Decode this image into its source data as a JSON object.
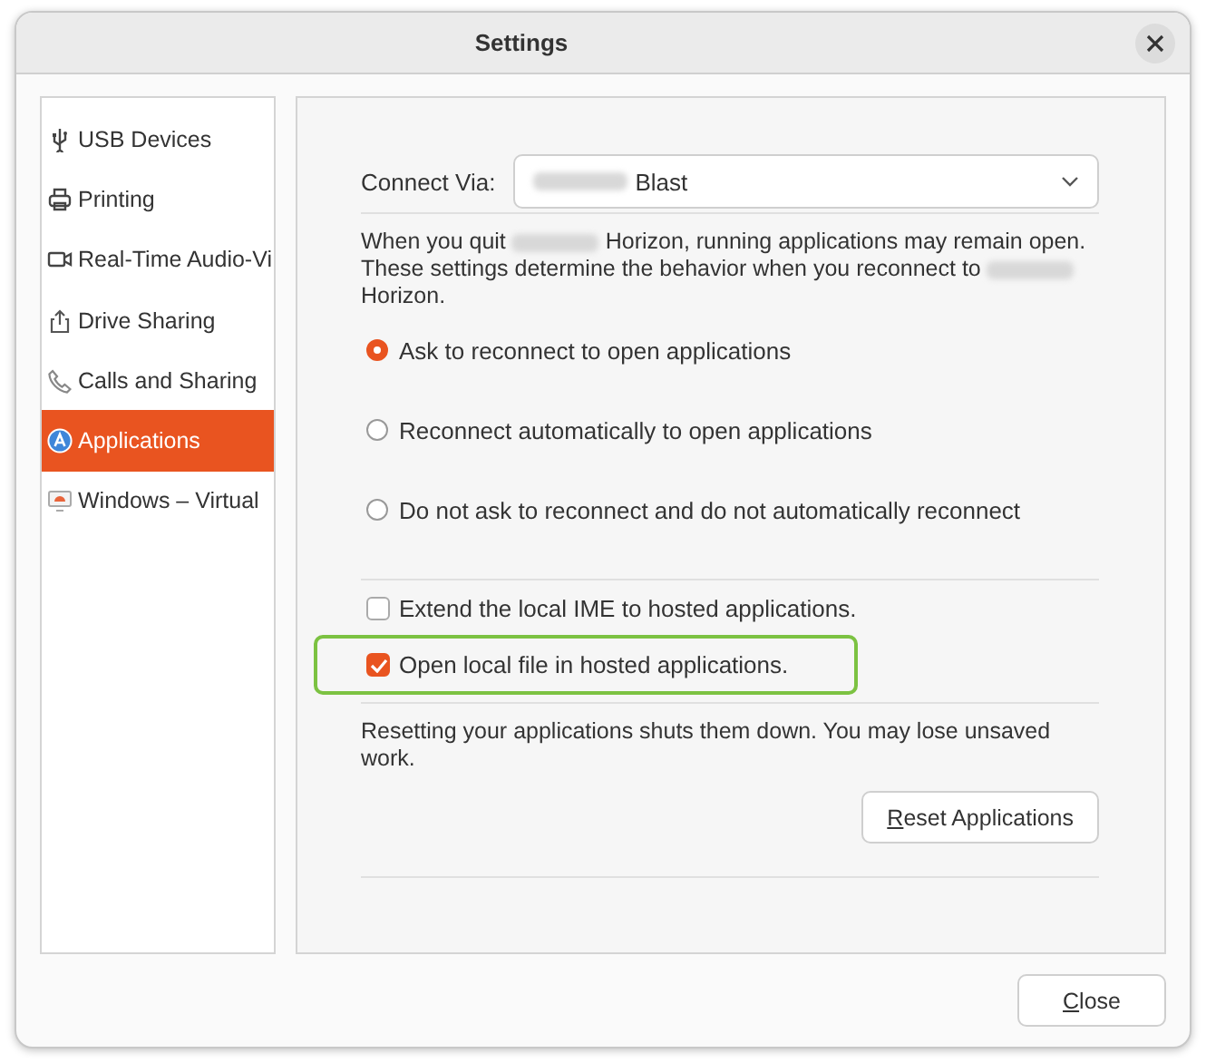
{
  "window": {
    "title": "Settings"
  },
  "sidebar": {
    "items": [
      {
        "label": "USB Devices",
        "selected": false
      },
      {
        "label": "Printing",
        "selected": false
      },
      {
        "label": "Real-Time Audio-Vi",
        "selected": false
      },
      {
        "label": "Drive Sharing",
        "selected": false
      },
      {
        "label": "Calls and Sharing",
        "selected": false
      },
      {
        "label": "Applications",
        "selected": true
      },
      {
        "label": "Windows – Virtual",
        "selected": false
      }
    ]
  },
  "connect": {
    "label": "Connect Via:",
    "value": "Blast",
    "redacted_prefix": true
  },
  "intro": {
    "parts": [
      "When you quit",
      "Horizon, running applications may remain open. These settings determine the behavior when you reconnect to",
      "Horizon."
    ]
  },
  "radios": [
    {
      "label": "Ask to reconnect to open applications",
      "selected": true
    },
    {
      "label": "Reconnect automatically to open applications",
      "selected": false
    },
    {
      "label": "Do not ask to reconnect and do not automatically reconnect",
      "selected": false
    }
  ],
  "checkboxes": [
    {
      "label": "Extend the local IME to hosted applications.",
      "checked": false,
      "highlighted": false
    },
    {
      "label": "Open local file in hosted applications.",
      "checked": true,
      "highlighted": true
    }
  ],
  "reset_note": "Resetting your applications shuts them down. You may lose unsaved work.",
  "reset_button": "Reset Applications",
  "close_button": "Close"
}
